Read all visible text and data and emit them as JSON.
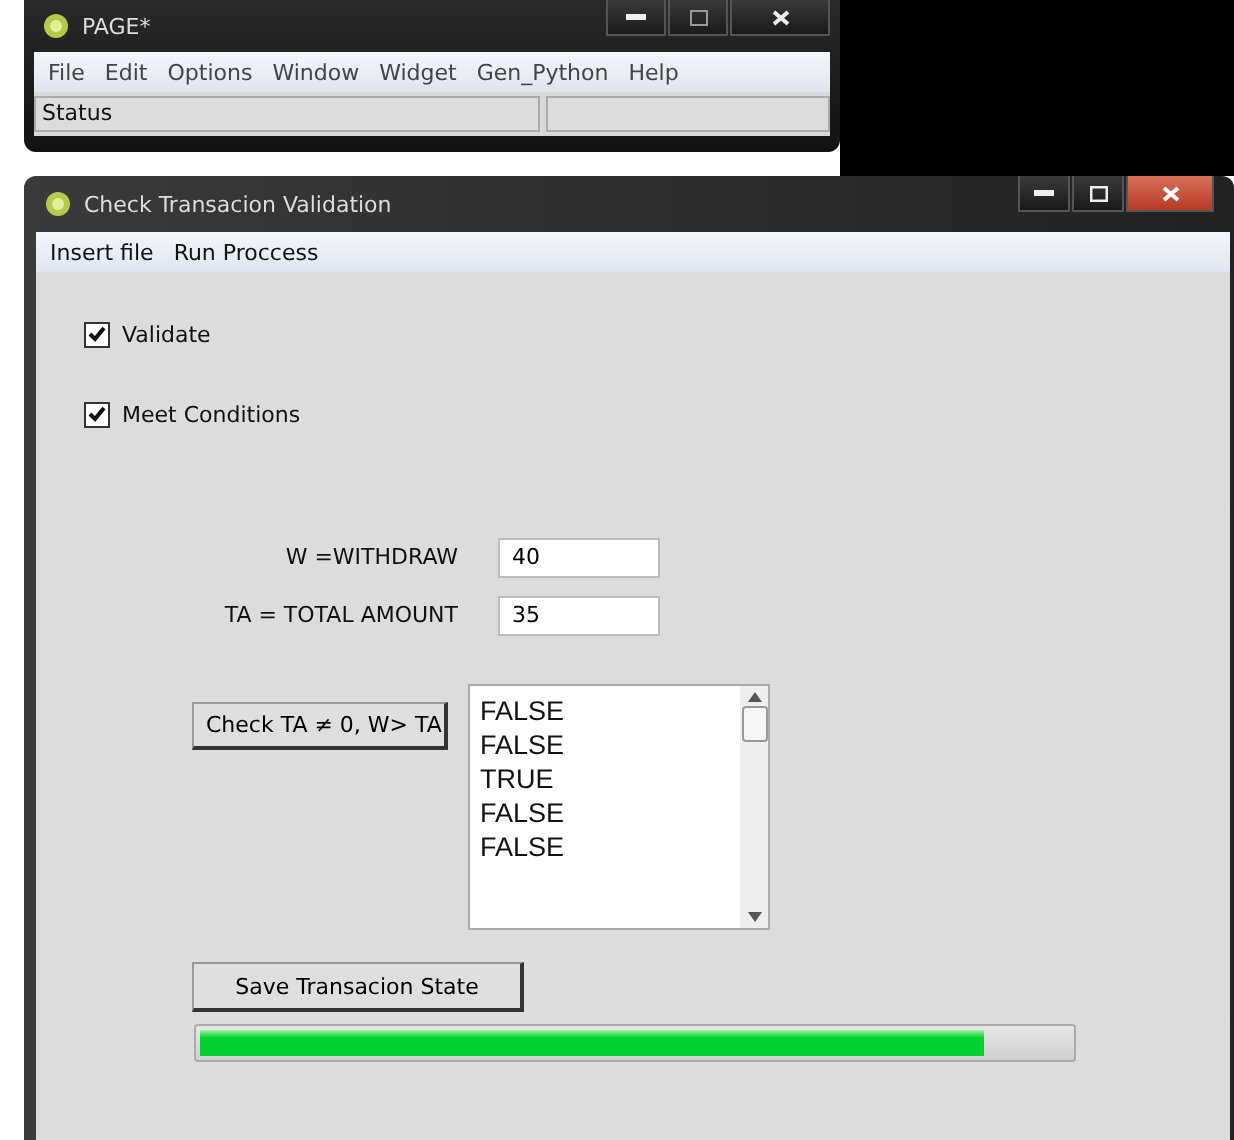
{
  "page_window": {
    "title": "PAGE*",
    "menu": [
      "File",
      "Edit",
      "Options",
      "Window",
      "Widget",
      "Gen_Python",
      "Help"
    ],
    "status_bar": "Status"
  },
  "window": {
    "title": "Check Transacion Validation",
    "menu": [
      "Insert file",
      "Run Proccess"
    ]
  },
  "checkboxes": [
    {
      "label": "Validate",
      "checked": true
    },
    {
      "label": "Meet Conditions",
      "checked": true
    }
  ],
  "fields": [
    {
      "label": "W =WITHDRAW",
      "value": "40"
    },
    {
      "label": "TA = TOTAL AMOUNT",
      "value": "35"
    }
  ],
  "check_button": "Check TA ≠ 0,  W> TA",
  "results": [
    "FALSE",
    "FALSE",
    "TRUE",
    "FALSE",
    "FALSE"
  ],
  "save_button": "Save Transacion State",
  "progress": {
    "level": 0.9
  }
}
